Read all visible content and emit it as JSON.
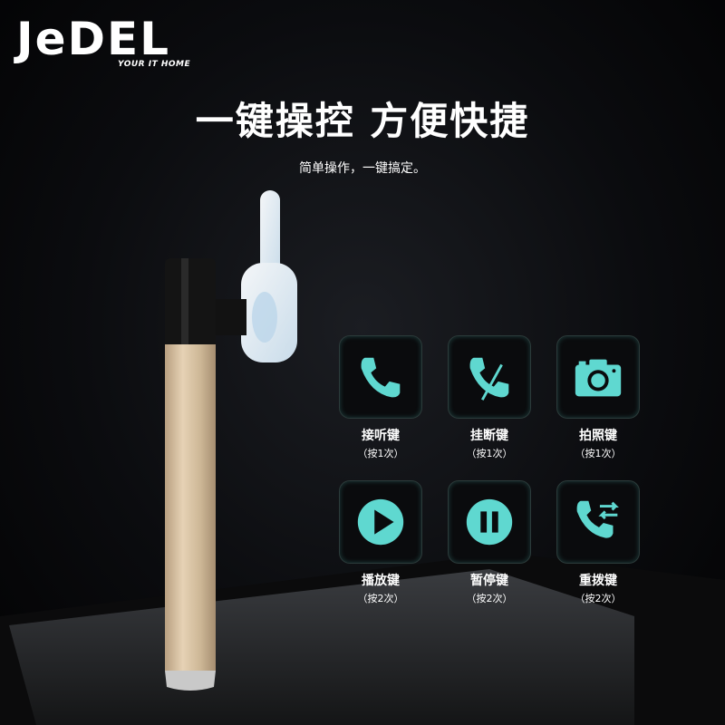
{
  "brand": {
    "logo": "JeDEL",
    "tagline": "YOUR IT HOME"
  },
  "headline": "一键操控 方便快捷",
  "subheadline": "简单操作，一键搞定。",
  "accent_color": "#5fd8d0",
  "features": [
    {
      "label": "接听键",
      "note": "（按1次）",
      "icon": "phone-answer-icon"
    },
    {
      "label": "挂断键",
      "note": "（按1次）",
      "icon": "phone-hangup-icon"
    },
    {
      "label": "拍照键",
      "note": "（按1次）",
      "icon": "camera-icon"
    },
    {
      "label": "播放键",
      "note": "（按2次）",
      "icon": "play-icon"
    },
    {
      "label": "暂停键",
      "note": "（按2次）",
      "icon": "pause-icon"
    },
    {
      "label": "重拨键",
      "note": "（按2次）",
      "icon": "redial-icon"
    }
  ]
}
